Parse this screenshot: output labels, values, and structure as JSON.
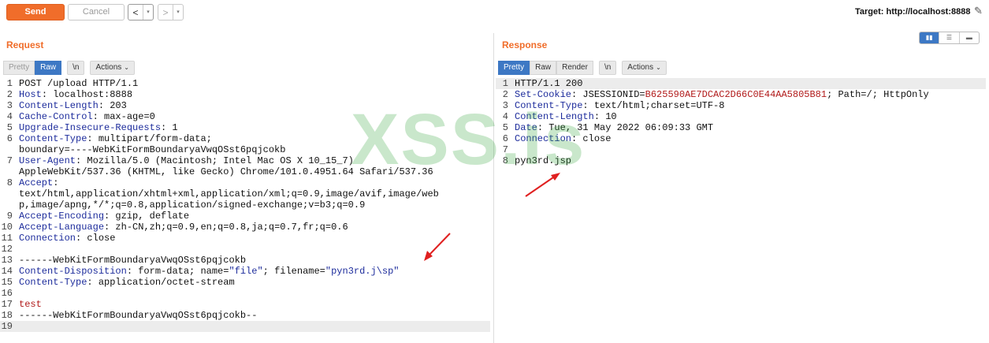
{
  "toolbar": {
    "send_label": "Send",
    "cancel_label": "Cancel",
    "back_arrow": "<",
    "forward_arrow": ">",
    "dropdown_glyph": "▾",
    "target_text": "Target: http://localhost:8888",
    "edit_icon": "pencil-icon"
  },
  "request": {
    "title": "Request",
    "tabs": [
      "Pretty",
      "Raw",
      "\\n",
      "Actions"
    ],
    "active_tab": "Raw",
    "lines": [
      {
        "n": "1",
        "k": "",
        "v": "POST /upload HTTP/1.1"
      },
      {
        "n": "2",
        "k": "Host",
        "v": " localhost:8888"
      },
      {
        "n": "3",
        "k": "Content-Length",
        "v": " 203"
      },
      {
        "n": "4",
        "k": "Cache-Control",
        "v": " max-age=0"
      },
      {
        "n": "5",
        "k": "Upgrade-Insecure-Requests",
        "v": " 1"
      },
      {
        "n": "6",
        "k": "Content-Type",
        "v": " multipart/form-data;"
      },
      {
        "n": "",
        "k": "",
        "v": "boundary=----WebKitFormBoundaryaVwqOSst6pqjcokb"
      },
      {
        "n": "7",
        "k": "User-Agent",
        "v": " Mozilla/5.0 (Macintosh; Intel Mac OS X 10_15_7)"
      },
      {
        "n": "",
        "k": "",
        "v": "AppleWebKit/537.36 (KHTML, like Gecko) Chrome/101.0.4951.64 Safari/537.36"
      },
      {
        "n": "8",
        "k": "Accept",
        "v": ""
      },
      {
        "n": "",
        "k": "",
        "v": "text/html,application/xhtml+xml,application/xml;q=0.9,image/avif,image/web"
      },
      {
        "n": "",
        "k": "",
        "v": "p,image/apng,*/*;q=0.8,application/signed-exchange;v=b3;q=0.9"
      },
      {
        "n": "9",
        "k": "Accept-Encoding",
        "v": " gzip, deflate"
      },
      {
        "n": "10",
        "k": "Accept-Language",
        "v": " zh-CN,zh;q=0.9,en;q=0.8,ja;q=0.7,fr;q=0.6"
      },
      {
        "n": "11",
        "k": "Connection",
        "v": " close"
      },
      {
        "n": "12",
        "k": "",
        "v": ""
      },
      {
        "n": "13",
        "k": "",
        "v": "------WebKitFormBoundaryaVwqOSst6pqjcokb"
      },
      {
        "n": "14",
        "k": "Content-Disposition",
        "v": " form-data; name=",
        "s1": "\"file\"",
        "v2": "; filename=",
        "s2": "\"pyn3rd.j\\sp\""
      },
      {
        "n": "15",
        "k": "Content-Type",
        "v": " application/octet-stream"
      },
      {
        "n": "16",
        "k": "",
        "v": ""
      },
      {
        "n": "17",
        "k": "",
        "v": "",
        "red": "test"
      },
      {
        "n": "18",
        "k": "",
        "v": "------WebKitFormBoundaryaVwqOSst6pqjcokb--"
      },
      {
        "n": "19",
        "k": "",
        "v": "",
        "hl": true
      }
    ]
  },
  "response": {
    "title": "Response",
    "tabs": [
      "Pretty",
      "Raw",
      "Render",
      "\\n",
      "Actions"
    ],
    "active_tab": "Pretty",
    "layout_icons": [
      "split-horizontal-icon",
      "split-vertical-icon",
      "single-pane-icon"
    ],
    "lines": [
      {
        "n": "1",
        "k": "",
        "v": "HTTP/1.1 200",
        "hl": true
      },
      {
        "n": "2",
        "k": "Set-Cookie",
        "v": " JSESSIONID=",
        "c": "B625590AE7DCAC2D66C0E44AA5805B81",
        "v2": "; Path=/; HttpOnly"
      },
      {
        "n": "3",
        "k": "Content-Type",
        "v": " text/html;charset=UTF-8"
      },
      {
        "n": "4",
        "k": "Content-Length",
        "v": " 10"
      },
      {
        "n": "5",
        "k": "Date",
        "v": " Tue, 31 May 2022 06:09:33 GMT"
      },
      {
        "n": "6",
        "k": "Connection",
        "v": " close"
      },
      {
        "n": "7",
        "k": "",
        "v": ""
      },
      {
        "n": "8",
        "k": "",
        "v": "pyn3rd.jsp"
      }
    ]
  },
  "watermark": "XSS.is",
  "colors": {
    "accent": "#f06d2a",
    "tab_active": "#3d78c4",
    "header_key": "#1d2c9c",
    "cookie": "#b11a1a",
    "arrow": "#e02020"
  }
}
